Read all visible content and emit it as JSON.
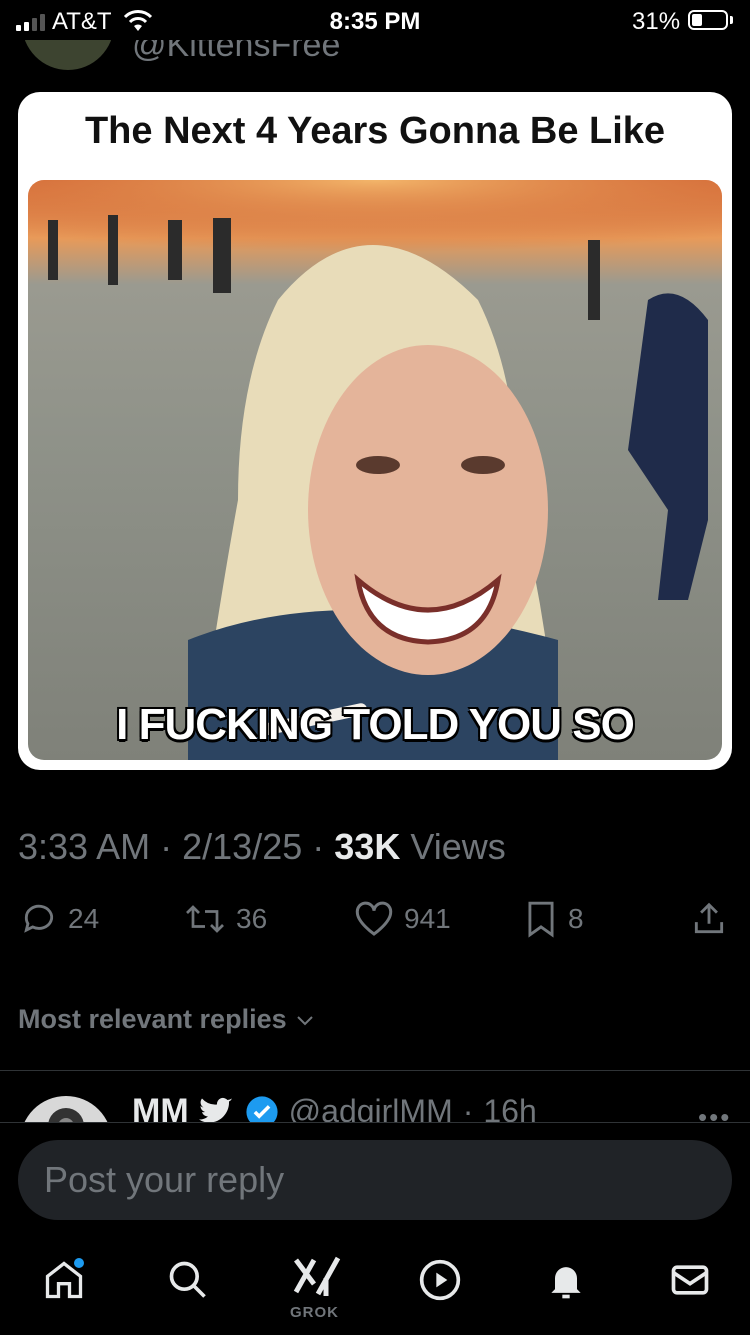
{
  "status_bar": {
    "carrier": "AT&T",
    "time": "8:35 PM",
    "battery": "31%"
  },
  "author": {
    "handle": "@KittensFree"
  },
  "post": {
    "meme_caption": "The Next 4 Years Gonna Be Like",
    "meme_overlay": "I FUCKING TOLD YOU SO",
    "time": "3:33 AM",
    "date": "2/13/25",
    "views_count": "33K",
    "views_label": "Views",
    "separator": "·"
  },
  "actions": {
    "replies": "24",
    "reposts": "36",
    "likes": "941",
    "bookmarks": "8"
  },
  "replies_filter": {
    "label": "Most relevant replies"
  },
  "reply": {
    "name": "MM",
    "handle": "@adgirlMM",
    "time": "16h"
  },
  "composer": {
    "placeholder": "Post your reply"
  },
  "bottom_nav": {
    "grok_label": "GROK"
  },
  "colors": {
    "background": "#000000",
    "text": "#e7e9ea",
    "muted": "#71767b",
    "accent": "#1d9bf0"
  }
}
